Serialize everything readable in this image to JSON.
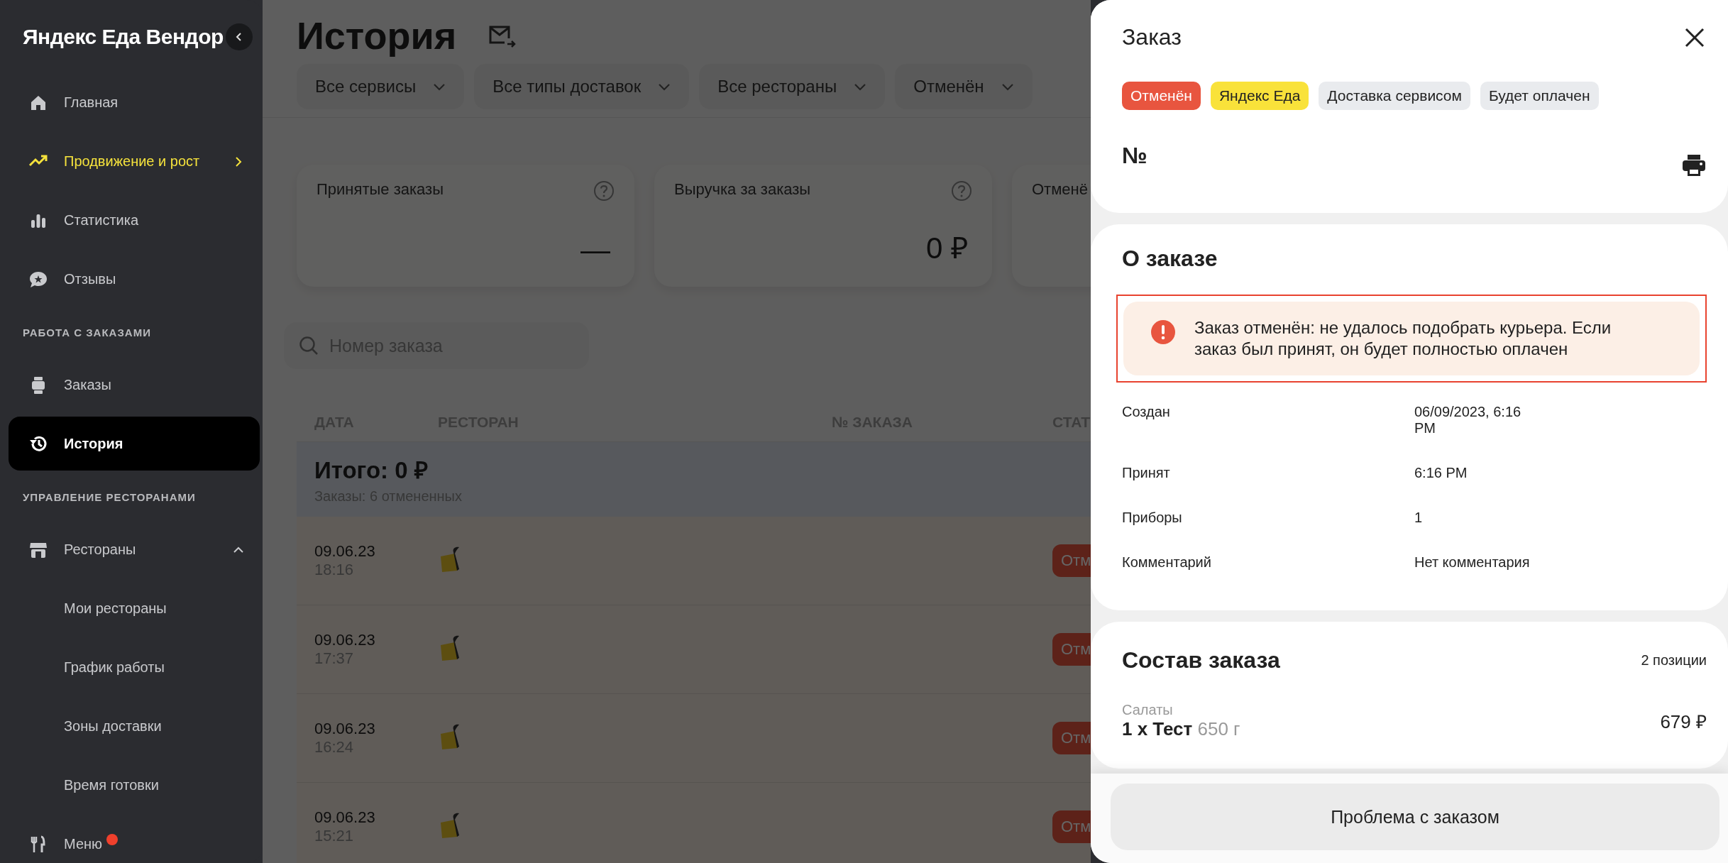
{
  "sidebar": {
    "logo": "Яндекс Еда Вендор",
    "items": [
      {
        "kind": "item",
        "label": "Главная",
        "selected": false
      },
      {
        "kind": "item",
        "label": "Продвижение и рост",
        "selected": false,
        "accent": true,
        "expanded": false
      },
      {
        "kind": "item",
        "label": "Статистика",
        "selected": false
      },
      {
        "kind": "item",
        "label": "Отзывы",
        "selected": false
      },
      {
        "kind": "section",
        "label": "РАБОТА С ЗАКАЗАМИ"
      },
      {
        "kind": "item",
        "label": "Заказы",
        "selected": false
      },
      {
        "kind": "item",
        "label": "История",
        "selected": true
      },
      {
        "kind": "section",
        "label": "УПРАВЛЕНИЕ РЕСТОРАНАМИ"
      },
      {
        "kind": "item",
        "label": "Рестораны",
        "selected": false,
        "expanded": true
      },
      {
        "kind": "subitem",
        "label": "Мои рестораны",
        "selected": false
      },
      {
        "kind": "subitem",
        "label": "График работы",
        "selected": false
      },
      {
        "kind": "subitem",
        "label": "Зоны доставки",
        "selected": false
      },
      {
        "kind": "subitem",
        "label": "Время готовки",
        "selected": false
      },
      {
        "kind": "item",
        "label": "Меню",
        "selected": false,
        "notification": true
      }
    ]
  },
  "main": {
    "title": "История",
    "filters": [
      {
        "label": "Все сервисы"
      },
      {
        "label": "Все типы доставок"
      },
      {
        "label": "Все рестораны"
      },
      {
        "label": "Отменён"
      }
    ],
    "stats": [
      {
        "label": "Принятые заказы",
        "value": "—",
        "help": true
      },
      {
        "label": "Выручка за заказы",
        "value": "0 ₽",
        "help": true
      },
      {
        "label": "Отменё",
        "help": false
      }
    ],
    "search": {
      "placeholder": "Номер заказа"
    },
    "table": {
      "columns": [
        "ДАТА",
        "РЕСТОРАН",
        "№ ЗАКАЗА",
        "СТАТ"
      ],
      "summary": {
        "total": "Итого: 0 ₽",
        "subtitle": "Заказы: 6 отмененных"
      },
      "rows": [
        {
          "date": "09.06.23",
          "time": "18:16",
          "status": "Отм"
        },
        {
          "date": "09.06.23",
          "time": "17:37",
          "status": "Отм"
        },
        {
          "date": "09.06.23",
          "time": "16:24",
          "status": "Отм"
        },
        {
          "date": "09.06.23",
          "time": "15:21",
          "status": "Отм"
        }
      ]
    }
  },
  "order_panel": {
    "title": "Заказ",
    "tags": [
      {
        "label": "Отменён",
        "color": "#e8553f"
      },
      {
        "label": "Яндекс Еда",
        "color": "#f9e23a"
      },
      {
        "label": "Доставка сервисом",
        "color": "#e9ebee"
      },
      {
        "label": "Будет оплачен",
        "color": "#e9ebee"
      }
    ],
    "number": "№",
    "about": {
      "title": "О заказе",
      "alert": "Заказ отменён: не удалось подобрать курьера. Если заказ был принят, он будет полностью оплачен",
      "details": [
        {
          "label": "Создан",
          "value": "06/09/2023, 6:16 PM"
        },
        {
          "label": "Принят",
          "value": "6:16 PM"
        },
        {
          "label": "Приборы",
          "value": "1"
        },
        {
          "label": "Комментарий",
          "value": "Нет комментария"
        }
      ]
    },
    "composition": {
      "title": "Состав заказа",
      "count": "2 позиции",
      "items": [
        {
          "category": "Салаты",
          "name": "1 x Тест",
          "weight": "650 г",
          "price": "679 ₽"
        }
      ]
    },
    "action": "Проблема с заказом"
  }
}
